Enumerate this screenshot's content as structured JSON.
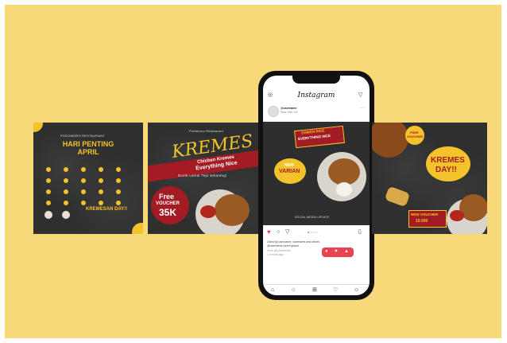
{
  "card1": {
    "restaurant": "PODOMORO RESTAURANT",
    "title_line1": "HARI PENTING",
    "title_line2": "APRIL",
    "event": "KREMESAN DAY!!"
  },
  "card2": {
    "header": "Podomoro Restaurant",
    "headline": "KREMES",
    "banner_line1": "Chicken Kremes",
    "banner_line2": "Everything Nice",
    "subline": "Booth Lamar Tepi sekarang!",
    "voucher_line1": "Free",
    "voucher_line2": "VOUCHER",
    "voucher_amount": "35K"
  },
  "instagram": {
    "app_title": "Instagram",
    "username": "@username",
    "location": "New York, NY",
    "post_banner_line1": "CHIKEN RICE",
    "post_banner_line2": "EVERYTHING NICE",
    "badge_line1": "NEW",
    "badge_line2": "VARIAN",
    "post_footer": "SOCIAL MEDIA UPDATE",
    "caption_line1": "Liked by username, username and others",
    "caption_line2": "@username lorem ipsum",
    "caption_line3": "View all comments",
    "caption_line4": "1 minute ago"
  },
  "card4": {
    "voucher_tag_line1": "FREE",
    "voucher_tag_line2": "VOUCHER",
    "headline_line1": "KREMES",
    "headline_line2": "DAY!!",
    "tag": "NEW VOUCHER",
    "tag_amount": "10.000"
  },
  "colors": {
    "background": "#f7d97a",
    "card": "#2f2f2f",
    "accent_yellow": "#f4c22b",
    "accent_red": "#a31c24",
    "like_red": "#e8434f"
  }
}
